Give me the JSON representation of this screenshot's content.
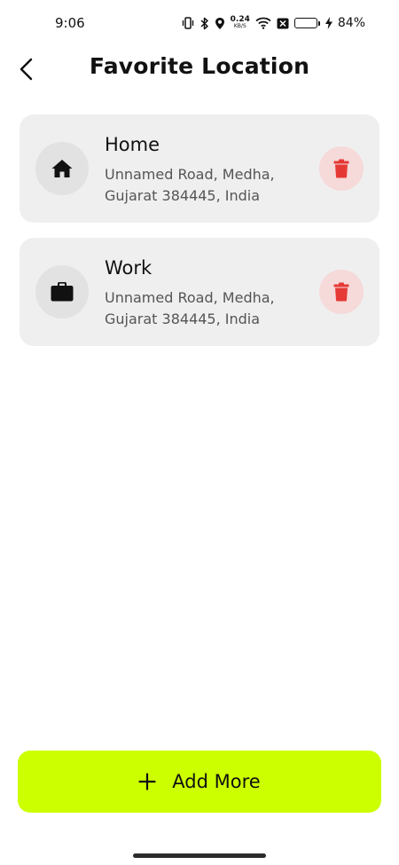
{
  "status_bar": {
    "time": "9:06",
    "net_speed_value": "0.24",
    "net_speed_unit": "KB/S",
    "battery_percent": "84%",
    "battery_level": 0.84,
    "icons": [
      "vibrate-icon",
      "bluetooth-icon",
      "location-pin-icon",
      "wifi-icon",
      "notification-x-icon",
      "battery-icon",
      "charging-bolt-icon"
    ]
  },
  "header": {
    "title": "Favorite Location",
    "back_icon": "chevron-left-icon"
  },
  "locations": [
    {
      "title": "Home",
      "address": "Unnamed Road, Medha, Gujarat 384445, India",
      "icon": "home-icon"
    },
    {
      "title": "Work",
      "address": "Unnamed Road, Medha, Gujarat 384445, India",
      "icon": "briefcase-icon"
    }
  ],
  "add_more": {
    "label": "Add More",
    "icon": "plus-icon"
  },
  "colors": {
    "accent": "#ccff00",
    "card_bg": "#efefef",
    "delete_red": "#e53935",
    "delete_bg": "#f6d9d9"
  }
}
